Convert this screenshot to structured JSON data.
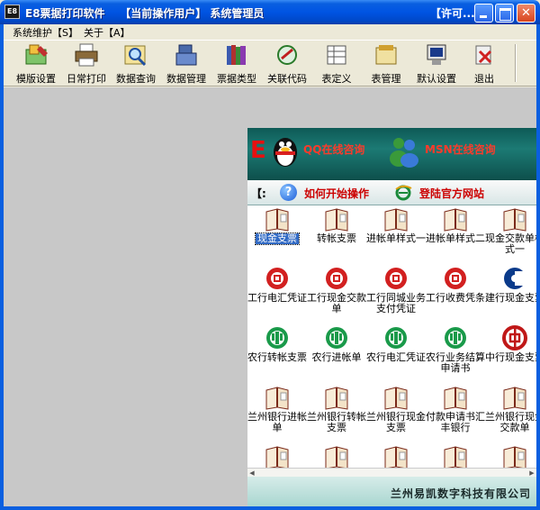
{
  "window": {
    "icon_text": "E8",
    "title": "E8票据打印软件    【当前操作用户】 系统管理员",
    "license": "【许可..."
  },
  "menu": [
    {
      "label": "系统维护【S】"
    },
    {
      "label": "关于【A】"
    }
  ],
  "toolbar": [
    {
      "label": "模版设置",
      "icon": "template-settings-icon"
    },
    {
      "label": "日常打印",
      "icon": "printer-icon"
    },
    {
      "label": "数据查询",
      "icon": "search-icon"
    },
    {
      "label": "数据管理",
      "icon": "data-manage-icon"
    },
    {
      "label": "票据类型",
      "icon": "books-icon"
    },
    {
      "label": "关联代码",
      "icon": "link-code-icon"
    },
    {
      "label": "表定义",
      "icon": "table-define-icon"
    },
    {
      "label": "表管理",
      "icon": "table-manage-icon"
    },
    {
      "label": "默认设置",
      "icon": "default-settings-icon"
    },
    {
      "label": "退出",
      "icon": "exit-icon"
    }
  ],
  "panel": {
    "qq_label": "QQ在线咨询",
    "msn_label": "MSN在线咨询",
    "help_bracket": "【:",
    "help_label": "如何开始操作",
    "site_label": "登陆官方网站",
    "footer": "兰州易凯数字科技有限公司"
  },
  "items": [
    {
      "label": "现金支票",
      "icon": "book-icon",
      "selected": true
    },
    {
      "label": "转帐支票",
      "icon": "book-icon"
    },
    {
      "label": "进帐单样式一",
      "icon": "book-icon"
    },
    {
      "label": "进帐单样式二",
      "icon": "book-icon"
    },
    {
      "label": "现金交款单样式一",
      "icon": "book-icon"
    },
    {
      "label": "工行电汇凭证",
      "icon": "icbc-logo-icon"
    },
    {
      "label": "工行现金交款单",
      "icon": "icbc-logo-icon"
    },
    {
      "label": "工行同城业务支付凭证",
      "icon": "icbc-logo-icon"
    },
    {
      "label": "工行收费凭条",
      "icon": "icbc-logo-icon"
    },
    {
      "label": "建行现金支票",
      "icon": "ccb-logo-icon"
    },
    {
      "label": "农行转帐支票",
      "icon": "abc-logo-icon"
    },
    {
      "label": "农行进帐单",
      "icon": "abc-logo-icon"
    },
    {
      "label": "农行电汇凭证",
      "icon": "abc-logo-icon"
    },
    {
      "label": "农行业务结算申请书",
      "icon": "abc-logo-icon"
    },
    {
      "label": "中行现金支票",
      "icon": "boc-logo-icon"
    },
    {
      "label": "兰州银行进帐单",
      "icon": "book-icon"
    },
    {
      "label": "兰州银行转帐支票",
      "icon": "book-icon"
    },
    {
      "label": "兰州银行现金支票",
      "icon": "book-icon"
    },
    {
      "label": "付款申请书汇丰银行",
      "icon": "book-icon"
    },
    {
      "label": "兰州银行现金交款单",
      "icon": "book-icon"
    },
    {
      "label": "",
      "icon": "book-icon"
    },
    {
      "label": "",
      "icon": "book-icon"
    },
    {
      "label": "",
      "icon": "book-icon"
    },
    {
      "label": "",
      "icon": "book-icon"
    },
    {
      "label": "",
      "icon": "book-icon"
    }
  ]
}
